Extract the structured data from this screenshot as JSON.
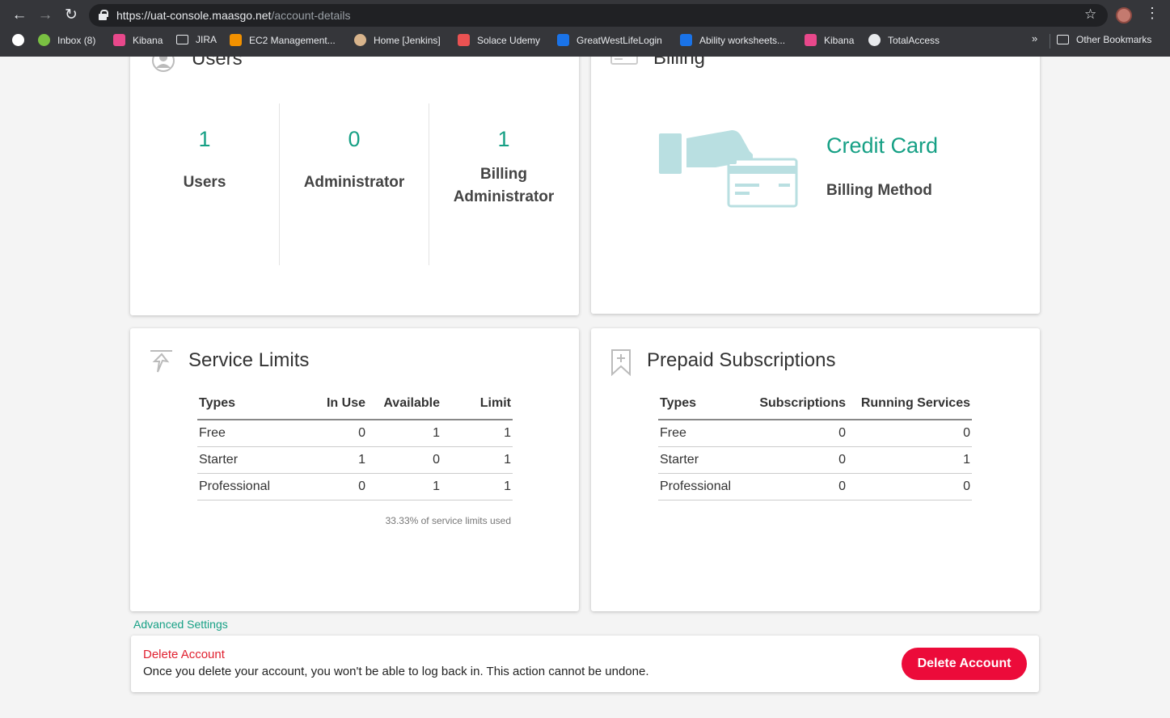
{
  "browser": {
    "url_host": "https://uat-console.maasgo.net",
    "url_path": "/account-details",
    "bookmarks": [
      {
        "label": "Inbox (8)",
        "icon": "evernote-icon",
        "color": "#7ac142"
      },
      {
        "label": "Kibana",
        "icon": "kibana-icon",
        "color": "#e8488b"
      },
      {
        "label": "JIRA",
        "icon": "folder-icon"
      },
      {
        "label": "EC2 Management...",
        "icon": "aws-icon",
        "color": "#f29100"
      },
      {
        "label": "Home [Jenkins]",
        "icon": "jenkins-icon",
        "color": "#d8b48c"
      },
      {
        "label": "Solace Udemy",
        "icon": "udemy-icon",
        "color": "#ea5252"
      },
      {
        "label": "GreatWestLifeLogin",
        "icon": "key-icon",
        "color": "#1a73e8"
      },
      {
        "label": "Ability worksheets...",
        "icon": "document-icon",
        "color": "#1a73e8"
      },
      {
        "label": "Kibana",
        "icon": "kibana-icon",
        "color": "#e8488b"
      },
      {
        "label": "TotalAccess",
        "icon": "globe-icon"
      }
    ],
    "other_bookmarks": "Other Bookmarks",
    "more_bookmarks": "»"
  },
  "users_card": {
    "title": "Users",
    "stats": [
      {
        "value": "1",
        "label": "Users"
      },
      {
        "value": "0",
        "label": "Administrator"
      },
      {
        "value": "1",
        "label": "Billing Administrator"
      }
    ]
  },
  "billing_card": {
    "title": "Billing",
    "method_value": "Credit Card",
    "method_label": "Billing Method"
  },
  "service_limits": {
    "title": "Service Limits",
    "headers": [
      "Types",
      "In Use",
      "Available",
      "Limit"
    ],
    "rows": [
      [
        "Free",
        "0",
        "1",
        "1"
      ],
      [
        "Starter",
        "1",
        "0",
        "1"
      ],
      [
        "Professional",
        "0",
        "1",
        "1"
      ]
    ],
    "footnote": "33.33% of service limits used"
  },
  "prepaid": {
    "title": "Prepaid Subscriptions",
    "headers": [
      "Types",
      "Subscriptions",
      "Running Services"
    ],
    "rows": [
      [
        "Free",
        "0",
        "0"
      ],
      [
        "Starter",
        "0",
        "1"
      ],
      [
        "Professional",
        "0",
        "0"
      ]
    ]
  },
  "advanced": {
    "link": "Advanced Settings",
    "danger_title": "Delete Account",
    "danger_desc": "Once you delete your account, you won't be able to log back in. This action cannot be undone.",
    "delete_button": "Delete Account"
  },
  "colors": {
    "accent": "#16a085",
    "danger": "#ec0b3a",
    "illustration": "#b9dfe1"
  }
}
